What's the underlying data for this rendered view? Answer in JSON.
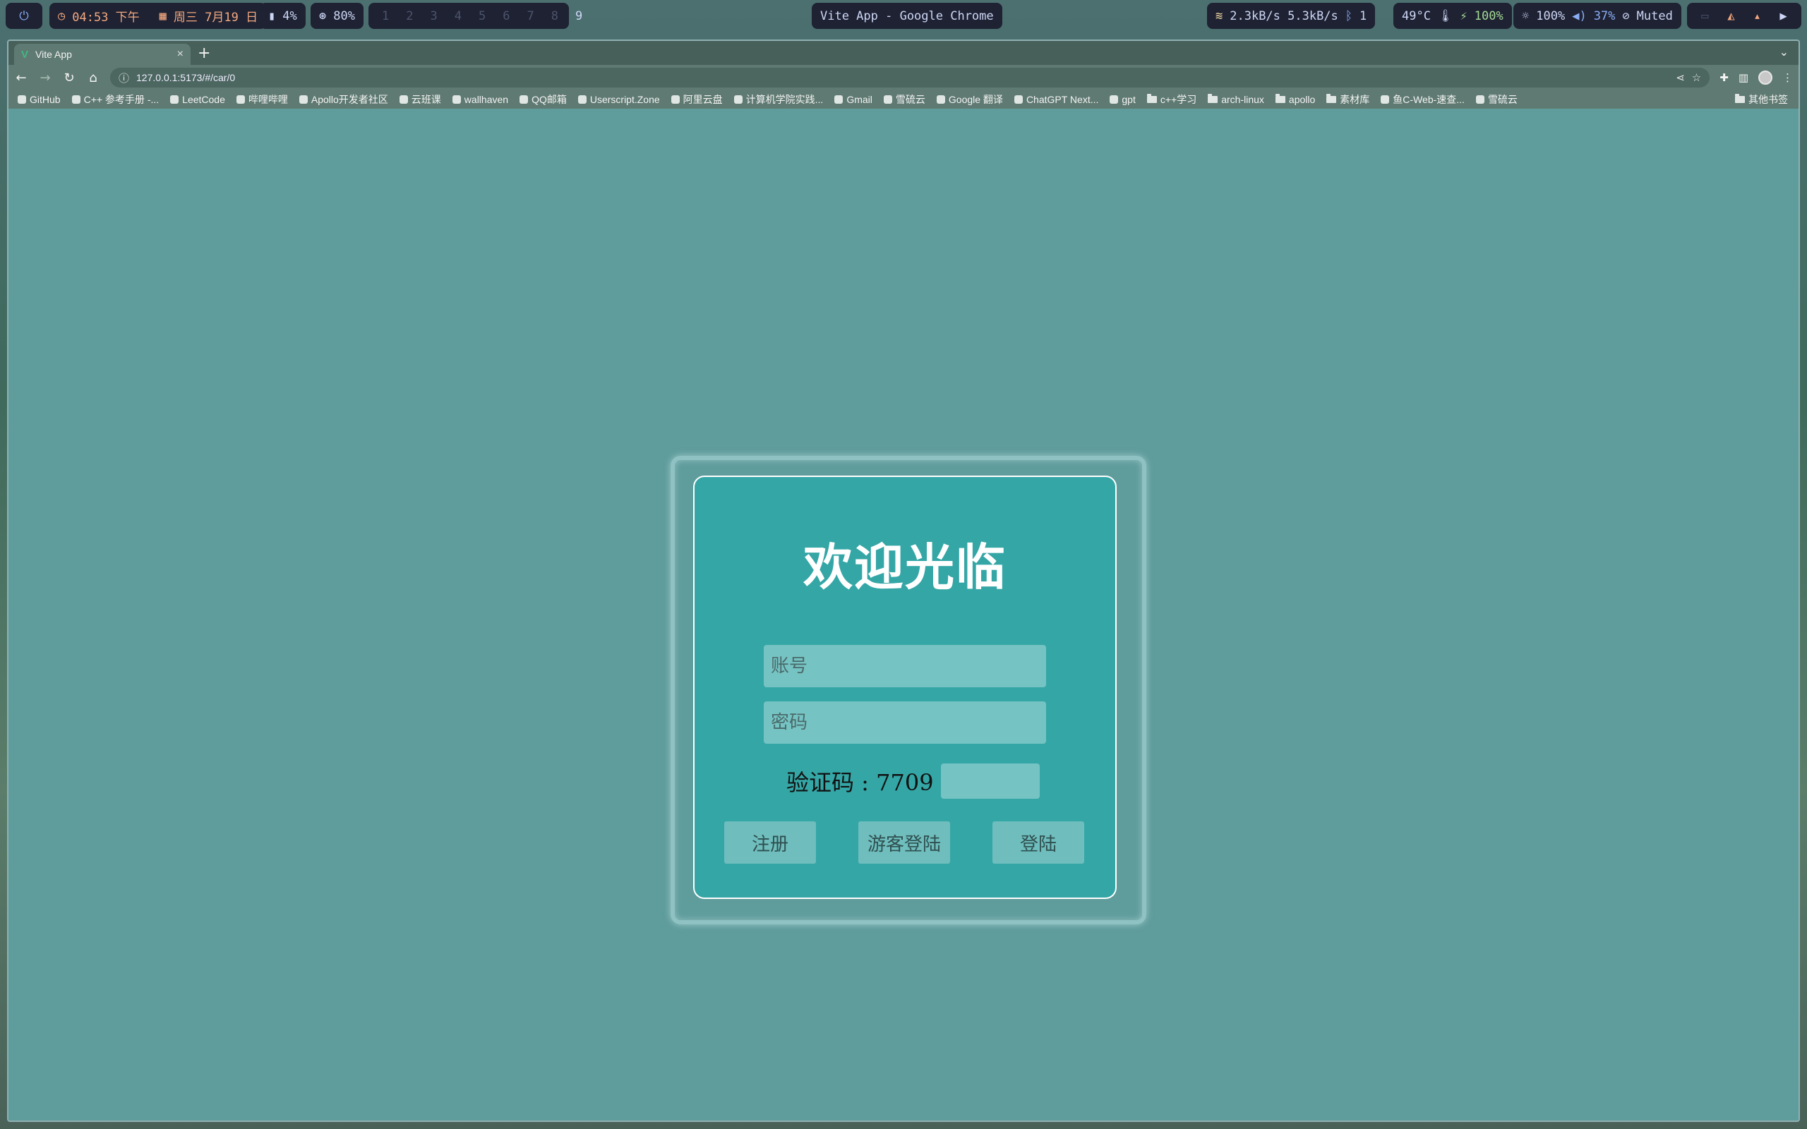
{
  "system_bar": {
    "power_icon": "power-icon",
    "time": "04:53 下午",
    "date": "周三 7月19 日",
    "memory": "4%",
    "cpu": "80%",
    "workspaces": [
      "1",
      "2",
      "3",
      "4",
      "5",
      "6",
      "7",
      "8",
      "9"
    ],
    "active_workspace": "9",
    "window_title": "Vite App - Google Chrome",
    "network": "2.3kB/s 5.3kB/s",
    "bluetooth": "1",
    "temperature": "49°C",
    "battery": "100%",
    "brightness": "100%",
    "volume": "37%",
    "mic": "Muted"
  },
  "browser": {
    "tab": {
      "title": "Vite App",
      "favicon": "V"
    },
    "address": "127.0.0.1:5173/#/car/0",
    "bookmarks": [
      {
        "label": "GitHub",
        "icon": "github-icon"
      },
      {
        "label": "C++ 参考手册 -...",
        "icon": "cpp-icon"
      },
      {
        "label": "LeetCode",
        "icon": "leetcode-icon"
      },
      {
        "label": "哔哩哔哩",
        "icon": "bilibili-icon"
      },
      {
        "label": "Apollo开发者社区",
        "icon": "apollo-icon"
      },
      {
        "label": "云班课",
        "icon": "cloud-class-icon"
      },
      {
        "label": "wallhaven",
        "icon": "wallhaven-icon"
      },
      {
        "label": "QQ邮箱",
        "icon": "qq-mail-icon"
      },
      {
        "label": "Userscript.Zone",
        "icon": "userscript-icon"
      },
      {
        "label": "阿里云盘",
        "icon": "aliyun-icon"
      },
      {
        "label": "计算机学院实践...",
        "icon": "school-icon"
      },
      {
        "label": "Gmail",
        "icon": "gmail-icon"
      },
      {
        "label": "雪硫云",
        "icon": "cloud-icon"
      },
      {
        "label": "Google 翻译",
        "icon": "translate-icon"
      },
      {
        "label": "ChatGPT Next...",
        "icon": "chatgpt-icon"
      },
      {
        "label": "gpt",
        "icon": "gpt-icon"
      },
      {
        "label": "c++学习",
        "icon": "folder-icon"
      },
      {
        "label": "arch-linux",
        "icon": "folder-icon"
      },
      {
        "label": "apollo",
        "icon": "folder-icon"
      },
      {
        "label": "素材库",
        "icon": "folder-icon"
      },
      {
        "label": "鱼C-Web-速查...",
        "icon": "fishc-icon"
      },
      {
        "label": "雪硫云",
        "icon": "cloud-icon"
      }
    ],
    "other_bookmarks": "其他书签"
  },
  "login": {
    "title": "欢迎光临",
    "account_placeholder": "账号",
    "password_placeholder": "密码",
    "captcha_label": "验证码 : 7709",
    "buttons": {
      "register": "注册",
      "guest": "游客登陆",
      "login": "登陆"
    }
  },
  "colors": {
    "page_bg": "#5f9c9c",
    "card_bg": "#35a6a6",
    "input_bg": "#76c3c3",
    "button_bg": "#6fbdbd",
    "title_text": "#ffffff"
  }
}
